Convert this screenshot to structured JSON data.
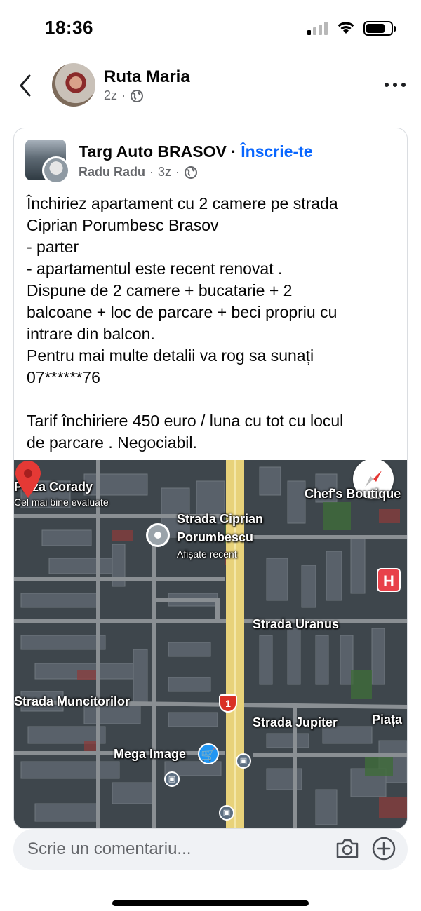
{
  "status_bar": {
    "time": "18:36",
    "signal_bars_active": 1,
    "battery_level": 0.75
  },
  "header": {
    "author_name": "Ruta Maria",
    "timestamp": "2z",
    "audience_icon": "globe-icon",
    "back_icon": "chevron-left-icon",
    "more_icon": "more-horizontal-icon"
  },
  "shared_post": {
    "group_name": "Targ Auto BRASOV",
    "separator": "·",
    "join_label": "Înscrie-te",
    "author": "Radu Radu",
    "dot": "·",
    "timestamp": "3z",
    "audience_icon": "globe-icon",
    "body_lines": [
      "Închiriez apartament cu 2 camere pe strada",
      "Ciprian Porumbesc Brasov",
      "- parter",
      "- apartamentul este recent renovat .",
      "Dispune de 2 camere + bucatarie + 2",
      "balcoane + loc de parcare + beci propriu cu",
      "intrare din balcon.",
      "Pentru mai multe detalii va rog sa sunați",
      "07******76",
      "",
      "Tarif închiriere 450 euro / luna cu tot cu locul",
      "de parcare . Negociabil."
    ]
  },
  "map": {
    "labels": {
      "pizza": "Pizza Corady",
      "pizza_sub": "Cel mai bine evaluate",
      "street_main": "Strada Ciprian",
      "street_main_2": "Porumbescu",
      "street_main_sub": "Afișate recent",
      "chefs": "Chef's Boutique",
      "uranus": "Strada Uranus",
      "muncitorilor": "Strada Muncitorilor",
      "jupiter": "Strada Jupiter",
      "piata": "Piața",
      "mega": "Mega Image",
      "hospital": "H",
      "route": "1"
    },
    "colors": {
      "main_road": "#e8d27a",
      "roads": "#8a8f93",
      "roofs": "#59616a",
      "pin": "#e53935",
      "hospital": "#e8414a",
      "shop": "#2196f3"
    }
  },
  "comment_bar": {
    "placeholder": "Scrie un comentariu...",
    "camera_icon": "camera-icon",
    "add_icon": "plus-circle-icon"
  }
}
